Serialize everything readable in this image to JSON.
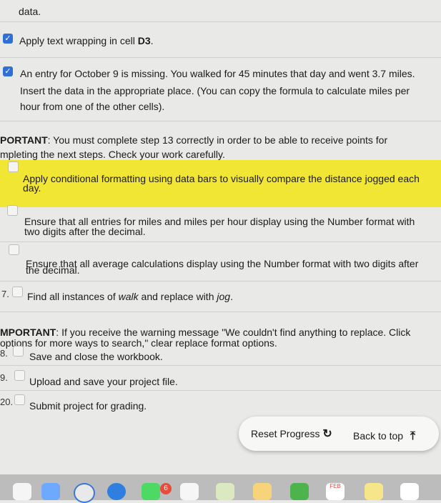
{
  "top_text": "data.",
  "item_11": {
    "label": "Apply text wrapping in cell ",
    "cell": "D3",
    "end": "."
  },
  "item_12": {
    "line1": "An entry for October 9 is missing. You walked for 45 minutes that day and went 3.7 miles.",
    "line2": "Insert the data in the appropriate place. (You can copy the formula to calculate miles per",
    "line3": "hour from one of the other cells)."
  },
  "important_1": {
    "bold": "PORTANT",
    "line1": ": You must complete step 13 correctly in order to be able to receive points for",
    "line2": "mpleting the next steps. Check your work carefully."
  },
  "item_13": {
    "line1": "Apply conditional formatting using data bars to visually compare the distance jogged each",
    "line2": "day."
  },
  "item_14": {
    "line1": "Ensure that all entries for miles and miles per hour display using the Number format with",
    "line2": "two digits after the decimal."
  },
  "item_15": {
    "line1": "Ensure that all average calculations display using the Number format with two digits after",
    "line2": "the decimal."
  },
  "item_16": {
    "num": "7.",
    "text_a": "Find all instances of ",
    "walk": "walk",
    "text_b": " and replace with ",
    "jog": "jog",
    "end": "."
  },
  "important_2": {
    "bold": "MPORTANT",
    "line1": ": If you receive the warning message \"We couldn't find anything to replace. Click",
    "line2": "ptions for more ways to search,\" clear replace format options."
  },
  "item_18": {
    "num": "8.",
    "label": "Save and close the workbook."
  },
  "item_19": {
    "num": "9.",
    "label": "Upload and save your project file."
  },
  "item_20": {
    "num": "20.",
    "label": "Submit project for grading."
  },
  "buttons": {
    "reset": "Reset Progress",
    "back_to_top": "Back to top"
  },
  "dock": {
    "badge": "6",
    "calendar_label": "FEB"
  },
  "colors": {
    "highlight": "#f2e634",
    "checkbox": "#2f6fd6"
  }
}
